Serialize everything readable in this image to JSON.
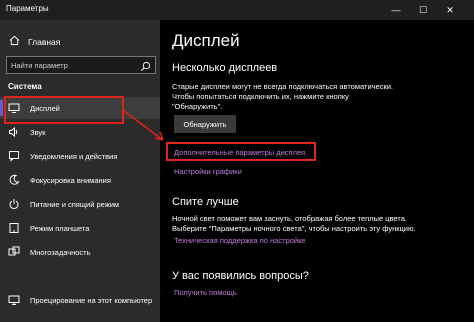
{
  "window": {
    "title": "Параметры",
    "minimize_glyph": "—",
    "maximize_glyph": "☐",
    "close_glyph": "✕"
  },
  "sidebar": {
    "home_label": "Главная",
    "search_placeholder": "Найти параметр",
    "section": "Система",
    "items": [
      {
        "label": "Дисплей",
        "icon": "monitor-icon",
        "active": true
      },
      {
        "label": "Звук",
        "icon": "speaker-icon"
      },
      {
        "label": "Уведомления и действия",
        "icon": "notification-icon"
      },
      {
        "label": "Фокусировка внимания",
        "icon": "moon-icon"
      },
      {
        "label": "Питание и спящий режим",
        "icon": "power-icon"
      },
      {
        "label": "Режим планшета",
        "icon": "tablet-icon"
      },
      {
        "label": "Многозадачность",
        "icon": "multitask-icon"
      },
      {
        "label": "Проецирование на этот компьютер",
        "icon": "projecting-icon"
      }
    ]
  },
  "main": {
    "title": "Дисплей",
    "multi_display": {
      "heading": "Несколько дисплеев",
      "description_1": "Старые дисплеи могут не всегда подключаться автоматически.",
      "description_2": "Чтобы попытаться подключить их, нажмите кнопку",
      "description_3": "\"Обнаружить\".",
      "detect_button": "Обнаружить",
      "advanced_link": "Дополнительные параметры дисплея",
      "graphics_link": "Настройки графики"
    },
    "sleep_better": {
      "heading": "Спите лучше",
      "description_1": "Ночной свет поможет вам заснуть, отображая более теплые цвета.",
      "description_2": "Выберите \"Параметры ночного света\", чтобы настроить эту функцию.",
      "support_link": "Техническая поддержка по настройке"
    },
    "questions": {
      "heading": "У вас появились вопросы?",
      "help_link": "Получить помощь"
    }
  },
  "colors": {
    "sidebar_bg": "#2b2b2b",
    "main_bg": "#000000",
    "link": "#c47ae0",
    "highlight": "#e0231b",
    "accent": "#6a5acd"
  }
}
